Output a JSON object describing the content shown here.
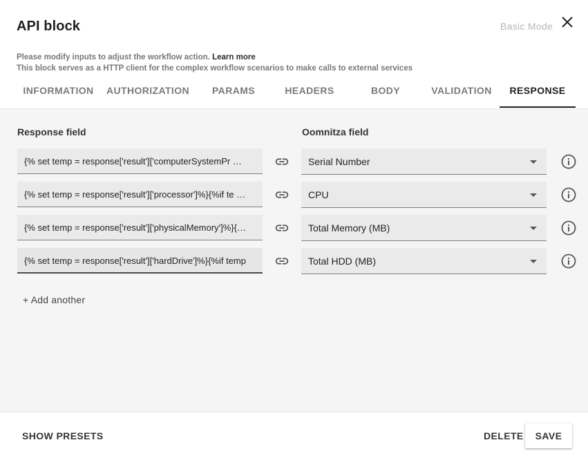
{
  "dialog": {
    "title": "API block",
    "mode_toggle": "Basic Mode"
  },
  "description": {
    "line1": "Please modify inputs to adjust the workflow action.",
    "learn_more": "Learn more",
    "line2": "This block serves as a HTTP client for the complex workflow scenarios to make calls to external services"
  },
  "tabs": [
    {
      "label": "INFORMATION",
      "active": false
    },
    {
      "label": "AUTHORIZATION",
      "active": false
    },
    {
      "label": "PARAMS",
      "active": false
    },
    {
      "label": "HEADERS",
      "active": false
    },
    {
      "label": "BODY",
      "active": false
    },
    {
      "label": "VALIDATION",
      "active": false
    },
    {
      "label": "RESPONSE",
      "active": true
    }
  ],
  "mapping": {
    "response_field_header": "Response field",
    "oomnitza_field_header": "Oomnitza field",
    "rows": [
      {
        "response": "{% set temp = response['result']['computerSystemPr  …",
        "field": "Serial Number"
      },
      {
        "response": "{% set temp = response['result']['processor']%}{%if te  …",
        "field": "CPU"
      },
      {
        "response": "{% set temp = response['result']['physicalMemory']%}{…",
        "field": "Total Memory (MB)"
      },
      {
        "response": "{% set temp = response['result']['hardDrive']%}{%if temp",
        "field": "Total HDD (MB)"
      }
    ],
    "add_another": "+ Add another"
  },
  "footer": {
    "show_presets": "SHOW PRESETS",
    "delete": "DELETE",
    "save": "SAVE"
  },
  "icons": {
    "close": "close-icon",
    "link": "link-icon",
    "info": "info-icon",
    "dropdown": "caret-down-icon"
  }
}
